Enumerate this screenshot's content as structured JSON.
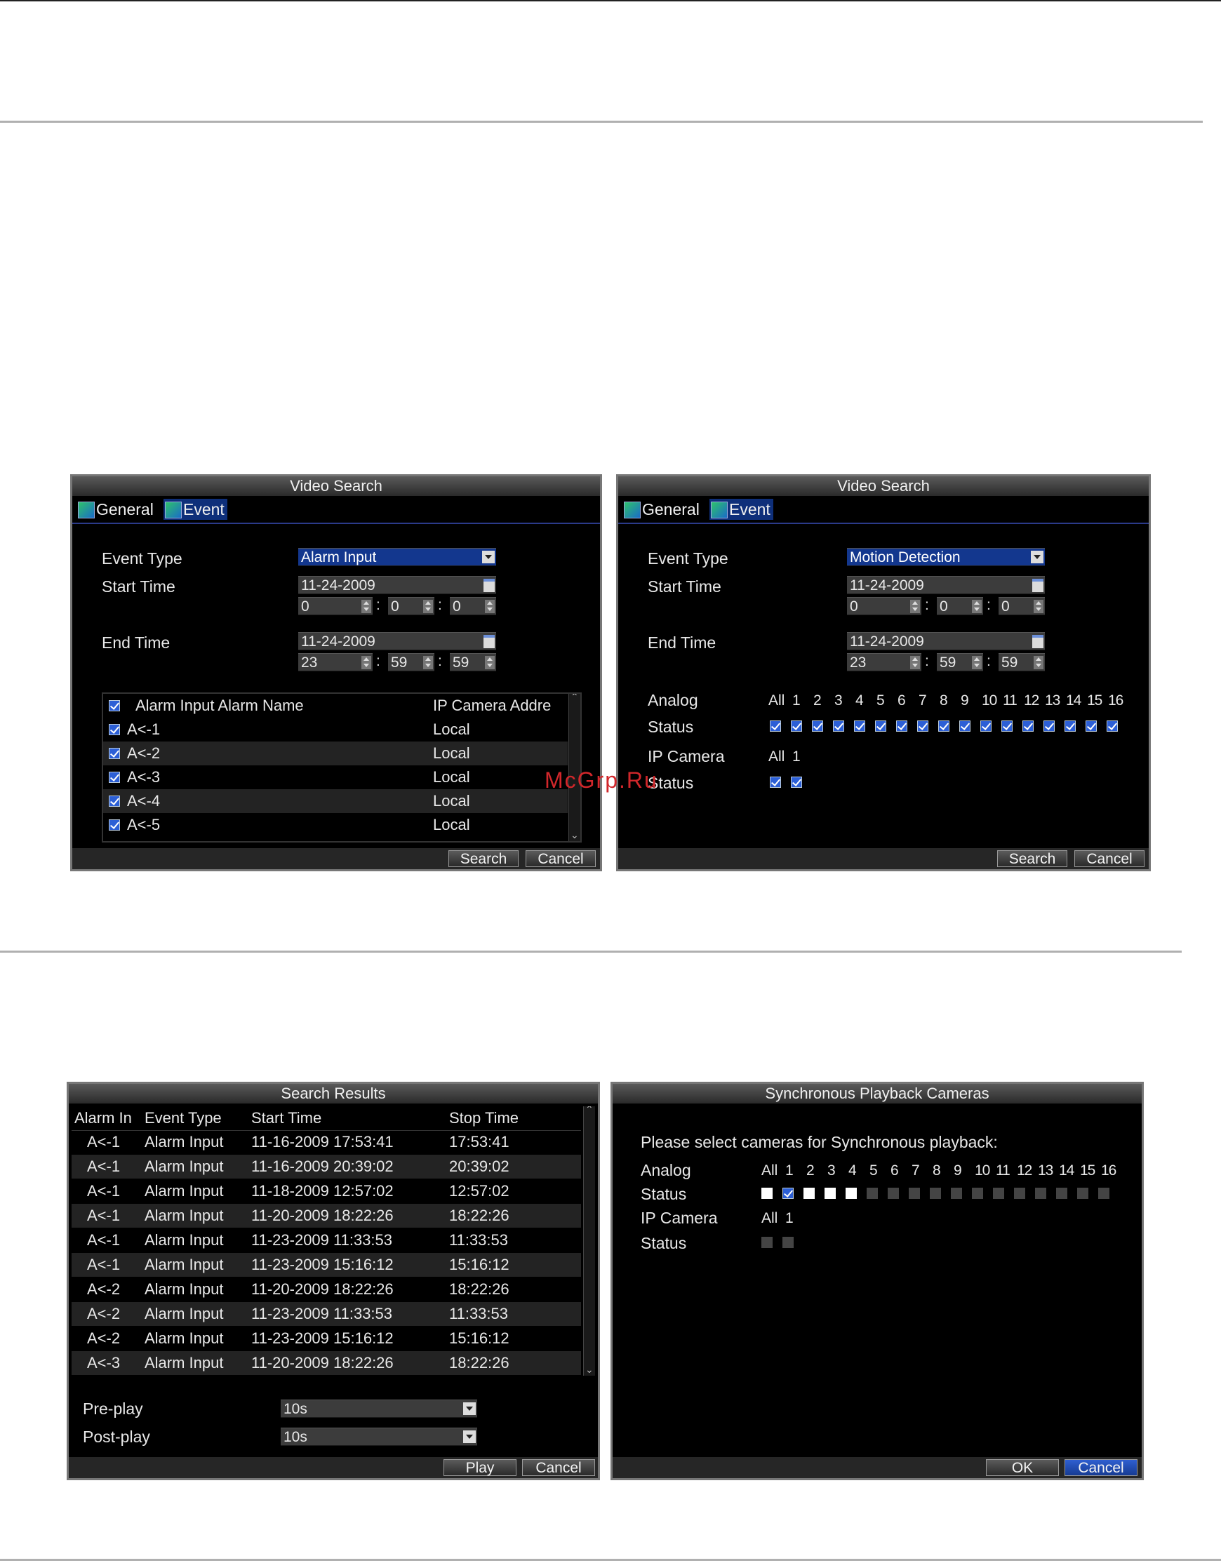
{
  "watermark": "McGrp.Ru",
  "video_search": {
    "title": "Video Search",
    "tabs": [
      "General",
      "Event"
    ],
    "left": {
      "event_type_label": "Event Type",
      "event_type_value": "Alarm Input",
      "start_time_label": "Start Time",
      "start_date": "11-24-2009",
      "start_h": "0",
      "start_m": "0",
      "start_s": "0",
      "end_time_label": "End Time",
      "end_date": "11-24-2009",
      "end_h": "23",
      "end_m": "59",
      "end_s": "59",
      "table_headers": [
        "Alarm Input Alarm Name",
        "IP Camera Addre"
      ],
      "rows": [
        {
          "name": "A<-1",
          "addr": "Local"
        },
        {
          "name": "A<-2",
          "addr": "Local"
        },
        {
          "name": "A<-3",
          "addr": "Local"
        },
        {
          "name": "A<-4",
          "addr": "Local"
        },
        {
          "name": "A<-5",
          "addr": "Local"
        }
      ],
      "search": "Search",
      "cancel": "Cancel"
    },
    "right": {
      "event_type_label": "Event Type",
      "event_type_value": "Motion Detection",
      "start_time_label": "Start Time",
      "start_date": "11-24-2009",
      "start_h": "0",
      "start_m": "0",
      "start_s": "0",
      "end_time_label": "End Time",
      "end_date": "11-24-2009",
      "end_h": "23",
      "end_m": "59",
      "end_s": "59",
      "analog_label": "Analog",
      "status_label": "Status",
      "ip_camera_label": "IP Camera",
      "status2_label": "Status",
      "analog_all": "All",
      "channels": [
        "1",
        "2",
        "3",
        "4",
        "5",
        "6",
        "7",
        "8",
        "9",
        "10",
        "11",
        "12",
        "13",
        "14",
        "15",
        "16"
      ],
      "ip_all": "All",
      "ip_channels": [
        "1"
      ],
      "search": "Search",
      "cancel": "Cancel"
    }
  },
  "search_results": {
    "title": "Search Results",
    "headers": [
      "Alarm In",
      "Event Type",
      "Start Time",
      "Stop Time"
    ],
    "rows": [
      [
        "A<-1",
        "Alarm Input",
        "11-16-2009 17:53:41",
        "17:53:41"
      ],
      [
        "A<-1",
        "Alarm Input",
        "11-16-2009 20:39:02",
        "20:39:02"
      ],
      [
        "A<-1",
        "Alarm Input",
        "11-18-2009 12:57:02",
        "12:57:02"
      ],
      [
        "A<-1",
        "Alarm Input",
        "11-20-2009 18:22:26",
        "18:22:26"
      ],
      [
        "A<-1",
        "Alarm Input",
        "11-23-2009 11:33:53",
        "11:33:53"
      ],
      [
        "A<-1",
        "Alarm Input",
        "11-23-2009 15:16:12",
        "15:16:12"
      ],
      [
        "A<-2",
        "Alarm Input",
        "11-20-2009 18:22:26",
        "18:22:26"
      ],
      [
        "A<-2",
        "Alarm Input",
        "11-23-2009 11:33:53",
        "11:33:53"
      ],
      [
        "A<-2",
        "Alarm Input",
        "11-23-2009 15:16:12",
        "15:16:12"
      ],
      [
        "A<-3",
        "Alarm Input",
        "11-20-2009 18:22:26",
        "18:22:26"
      ]
    ],
    "preplay_label": "Pre-play",
    "preplay_value": "10s",
    "postplay_label": "Post-play",
    "postplay_value": "10s",
    "play": "Play",
    "cancel": "Cancel"
  },
  "sync_playback": {
    "title": "Synchronous Playback Cameras",
    "prompt": "Please select cameras for Synchronous playback:",
    "analog_label": "Analog",
    "status_label": "Status",
    "ip_camera_label": "IP Camera",
    "status2_label": "Status",
    "analog_all": "All",
    "channels": [
      "1",
      "2",
      "3",
      "4",
      "5",
      "6",
      "7",
      "8",
      "9",
      "10",
      "11",
      "12",
      "13",
      "14",
      "15",
      "16"
    ],
    "ip_all": "All",
    "ip_channels": [
      "1"
    ],
    "ok": "OK",
    "cancel": "Cancel"
  }
}
